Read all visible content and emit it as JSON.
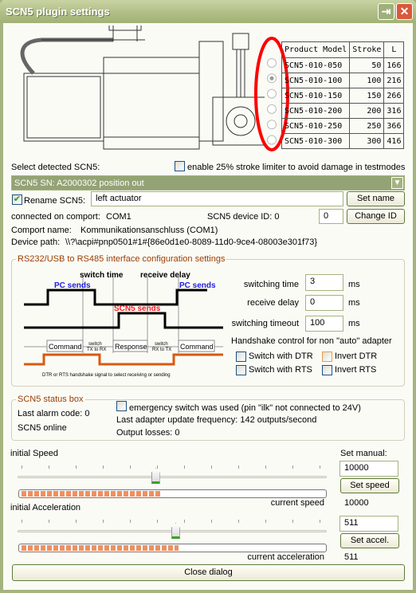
{
  "window": {
    "title": "SCN5 plugin settings",
    "restore_icon": "restore-icon",
    "close_icon": "close-icon"
  },
  "product_table": {
    "headers": [
      "Product Model",
      "Stroke",
      "L"
    ],
    "rows": [
      [
        "SCN5-010-050",
        "50",
        "166"
      ],
      [
        "SCN5-010-100",
        "100",
        "216"
      ],
      [
        "SCN5-010-150",
        "150",
        "266"
      ],
      [
        "SCN5-010-200",
        "200",
        "316"
      ],
      [
        "SCN5-010-250",
        "250",
        "366"
      ],
      [
        "SCN5-010-300",
        "300",
        "416"
      ]
    ],
    "selected_index": 1
  },
  "device": {
    "select_label": "Select detected SCN5:",
    "stroke_limiter_label": "enable 25% stroke limiter to avoid damage in testmodes",
    "stroke_limiter_checked": false,
    "selected_device": "SCN5 SN: A2000302 position out",
    "rename_label": "Rename SCN5:",
    "rename_checked": true,
    "name_value": "left actuator",
    "set_name": "Set name",
    "comport_label": "connected on comport:",
    "comport": "COM1",
    "device_id_label": "SCN5 device ID: 0",
    "device_id_value": "0",
    "change_id": "Change ID",
    "comport_name_label": "Comport name:",
    "comport_name": "Kommunikationsanschluss (COM1)",
    "device_path_label": "Device path:",
    "device_path": "\\\\?\\acpi#pnp0501#1#{86e0d1e0-8089-11d0-9ce4-08003e301f73}"
  },
  "interface": {
    "legend": "RS232/USB to RS485 interface configuration settings",
    "diagram": {
      "switch_time": "switch time",
      "receive_delay": "receive delay",
      "pc_sends": "PC sends",
      "scn5_sends": "SCN5 sends",
      "command": "Command",
      "switch": "switch",
      "tx_to_rx": "TX to RX",
      "response": "Response",
      "rx_to_tx": "RX to TX",
      "handshake_caption": "DTR or RTS handshake signal to select receiving or sending"
    },
    "switching_time_label": "switching time",
    "switching_time": "3",
    "receive_delay_label": "receive delay",
    "receive_delay": "0",
    "switching_timeout_label": "switching timeout",
    "switching_timeout": "100",
    "unit": "ms",
    "handshake_label": "Handshake control for non \"auto\" adapter",
    "options": [
      {
        "label": "Switch with DTR",
        "checked": false
      },
      {
        "label": "Invert DTR",
        "checked": false
      },
      {
        "label": "Switch with RTS",
        "checked": false
      },
      {
        "label": "Invert RTS",
        "checked": false
      }
    ]
  },
  "status": {
    "legend": "SCN5 status box",
    "alarm": "Last alarm code: 0",
    "online": "SCN5 online",
    "emergency_label": "emergency switch was used (pin \"ilk\" not connected to 24V)",
    "emergency_checked": false,
    "frequency": "Last adapter update frequency: 142 outputs/second",
    "losses": "Output losses: 0"
  },
  "speed": {
    "label": "initial Speed",
    "set_manual": "Set manual:",
    "value": "10000",
    "button": "Set speed",
    "current_label": "current speed",
    "current": "10000",
    "slider_fraction": 0.445,
    "progress_fraction": 0.46
  },
  "accel": {
    "label": "initial Acceleration",
    "value": "511",
    "button": "Set accel.",
    "current_label": "current acceleration",
    "current": "511",
    "slider_fraction": 0.51,
    "progress_fraction": 0.52
  },
  "close": "Close dialog",
  "colors": {
    "accent": "#a5b37f",
    "legend": "#9b3d00",
    "dropdown": "#94a375",
    "highlight": "#ff0000"
  }
}
